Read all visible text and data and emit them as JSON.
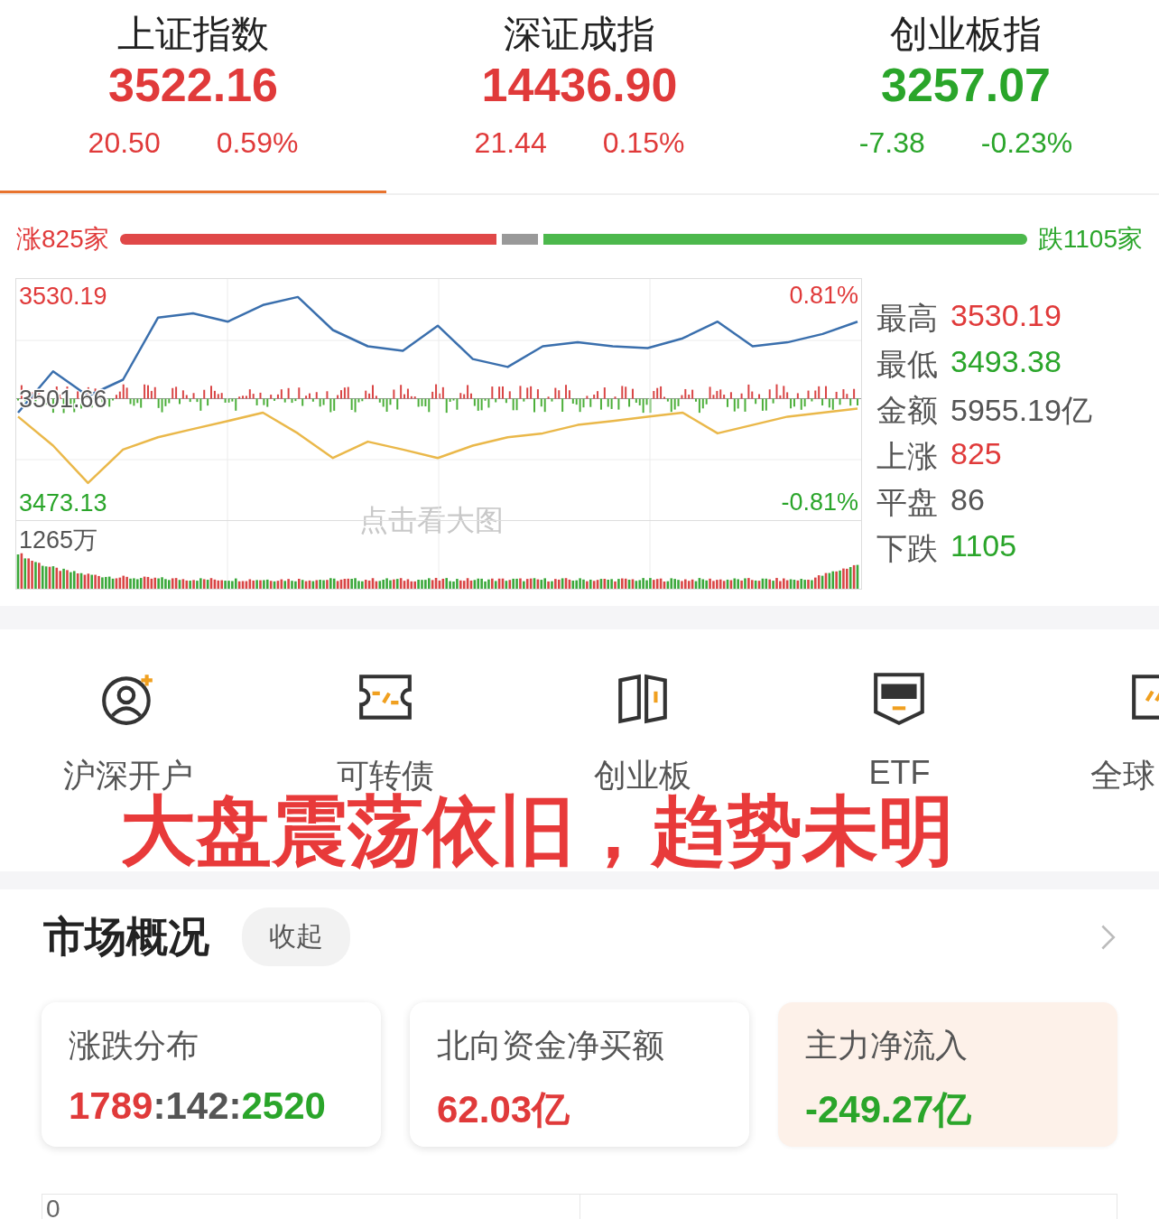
{
  "indices": [
    {
      "name": "上证指数",
      "value": "3522.16",
      "change": "20.50",
      "percent": "0.59%",
      "color": "#e03a3a",
      "selected": true
    },
    {
      "name": "深证成指",
      "value": "14436.90",
      "change": "21.44",
      "percent": "0.15%",
      "color": "#e03a3a",
      "selected": false
    },
    {
      "name": "创业板指",
      "value": "3257.07",
      "change": "-7.38",
      "percent": "-0.23%",
      "color": "#2aa52a",
      "selected": false
    }
  ],
  "breadth": {
    "up_label": "涨825家",
    "down_label": "跌1105家"
  },
  "chart": {
    "high_pct": "0.81%",
    "low_pct": "-0.81%",
    "volume_label": "1265万",
    "hint": "点击看大图",
    "chart_data": {
      "type": "line",
      "grid": true,
      "ylim": [
        3468.15,
        3534.67
      ],
      "yticks": [
        {
          "value": 3530.19,
          "label": "3530.19"
        },
        {
          "value": 3501.66,
          "label": "3501.66"
        },
        {
          "value": 3473.13,
          "label": "3473.13"
        }
      ],
      "series": [
        {
          "color": "#3a6fad",
          "values": [
            3497.8,
            3509.2,
            3502.4,
            3506.9,
            3524.0,
            3525.2,
            3522.9,
            3527.5,
            3529.7,
            3520.6,
            3516.1,
            3514.9,
            3521.8,
            3512.6,
            3510.4,
            3516.1,
            3517.2,
            3516.1,
            3515.6,
            3518.3,
            3522.9,
            3516.1,
            3517.2,
            3519.5,
            3522.9
          ]
        },
        {
          "color": "#eab84a",
          "values": [
            3496.7,
            3488.7,
            3478.4,
            3487.6,
            3491.0,
            3493.3,
            3495.5,
            3497.8,
            3492.1,
            3485.3,
            3489.8,
            3487.6,
            3485.3,
            3488.7,
            3491.0,
            3492.1,
            3494.4,
            3495.5,
            3496.7,
            3497.8,
            3492.1,
            3494.4,
            3496.7,
            3497.8,
            3498.9
          ]
        }
      ]
    }
  },
  "stats": [
    {
      "label": "最高",
      "value": "3530.19",
      "color": "#e03a3a"
    },
    {
      "label": "最低",
      "value": "3493.38",
      "color": "#2aa52a"
    },
    {
      "label": "金额",
      "value": "5955.19亿",
      "color": "#555555"
    },
    {
      "label": "上涨",
      "value": "825",
      "color": "#e03a3a"
    },
    {
      "label": "平盘",
      "value": "86",
      "color": "#555555"
    },
    {
      "label": "下跌",
      "value": "1105",
      "color": "#2aa52a"
    }
  ],
  "shortcuts": [
    {
      "label": "沪深开户",
      "kind": "account"
    },
    {
      "label": "可转债",
      "kind": "ticket"
    },
    {
      "label": "创业板",
      "kind": "board"
    },
    {
      "label": "ETF",
      "kind": "etf"
    },
    {
      "label": "全球",
      "kind": "global"
    }
  ],
  "caption": "大盘震荡依旧，趋势未明",
  "overview": {
    "title": "市场概况",
    "collapse_button": "收起",
    "cards": [
      {
        "title": "涨跌分布",
        "parts": [
          {
            "text": "1789",
            "color": "#e03a3a"
          },
          {
            "text": ":142:",
            "color": "#555555"
          },
          {
            "text": "2520",
            "color": "#2aa52a"
          }
        ],
        "selected": false
      },
      {
        "title": "北向资金净买额",
        "parts": [
          {
            "text": "62.03亿",
            "color": "#e03a3a"
          }
        ],
        "selected": false
      },
      {
        "title": "主力净流入",
        "parts": [
          {
            "text": "-249.27亿",
            "color": "#2aa52a"
          }
        ],
        "selected": true
      }
    ],
    "axis_label": "0"
  }
}
